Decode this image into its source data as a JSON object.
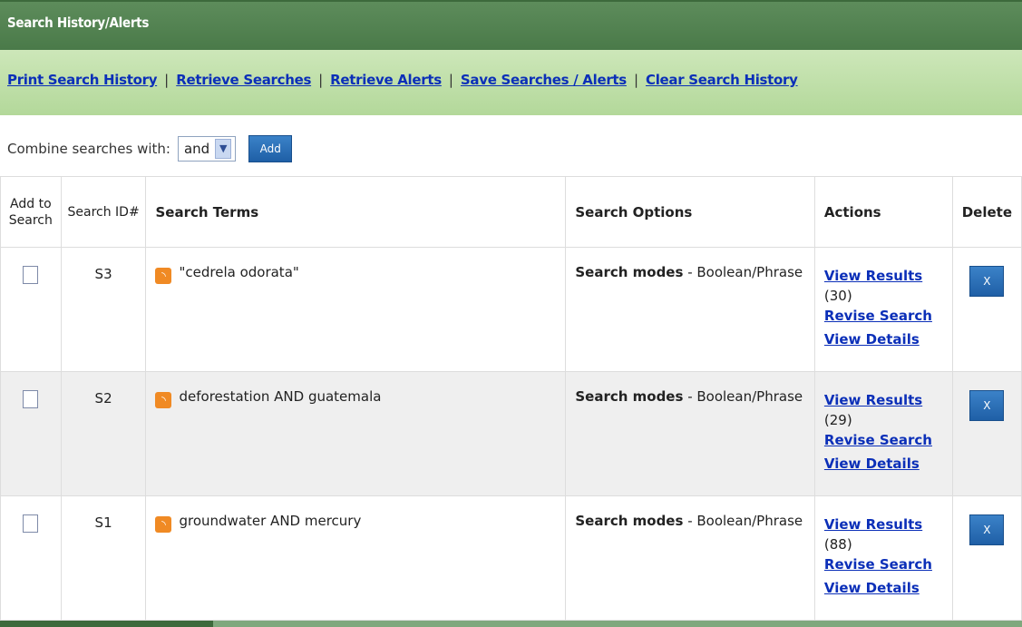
{
  "header": {
    "title": "Search History/Alerts"
  },
  "links": [
    {
      "label": "Print Search History"
    },
    {
      "label": "Retrieve Searches"
    },
    {
      "label": "Retrieve Alerts"
    },
    {
      "label": "Save Searches / Alerts"
    },
    {
      "label": "Clear Search History"
    }
  ],
  "combine": {
    "label": "Combine searches with:",
    "selected": "and",
    "add_label": "Add"
  },
  "table": {
    "headers": {
      "add": "Add to Search",
      "id": "Search ID#",
      "terms": "Search Terms",
      "options": "Search Options",
      "actions": "Actions",
      "delete": "Delete"
    },
    "rows": [
      {
        "id": "S3",
        "terms": "\"cedrela odorata\"",
        "option_label": "Search modes",
        "option_value": "- Boolean/Phrase",
        "view_results": "View Results",
        "count": "(30)",
        "revise": "Revise Search",
        "details": "View Details",
        "delete_label": "X"
      },
      {
        "id": "S2",
        "terms": "deforestation AND guatemala",
        "option_label": "Search modes",
        "option_value": "- Boolean/Phrase",
        "view_results": "View Results",
        "count": "(29)",
        "revise": "Revise Search",
        "details": "View Details",
        "delete_label": "X"
      },
      {
        "id": "S1",
        "terms": "groundwater AND mercury",
        "option_label": "Search modes",
        "option_value": "- Boolean/Phrase",
        "view_results": "View Results",
        "count": "(88)",
        "revise": "Revise Search",
        "details": "View Details",
        "delete_label": "X"
      }
    ]
  },
  "colors": {
    "header_green": "#4a7a49",
    "links_bar": "#bfe0a8",
    "link_blue": "#0b2fb8",
    "button_blue": "#2a6db5",
    "rss_orange": "#f08a24"
  },
  "icons": {
    "rss": "rss-feed-icon",
    "dropdown": "chevron-down-icon"
  }
}
